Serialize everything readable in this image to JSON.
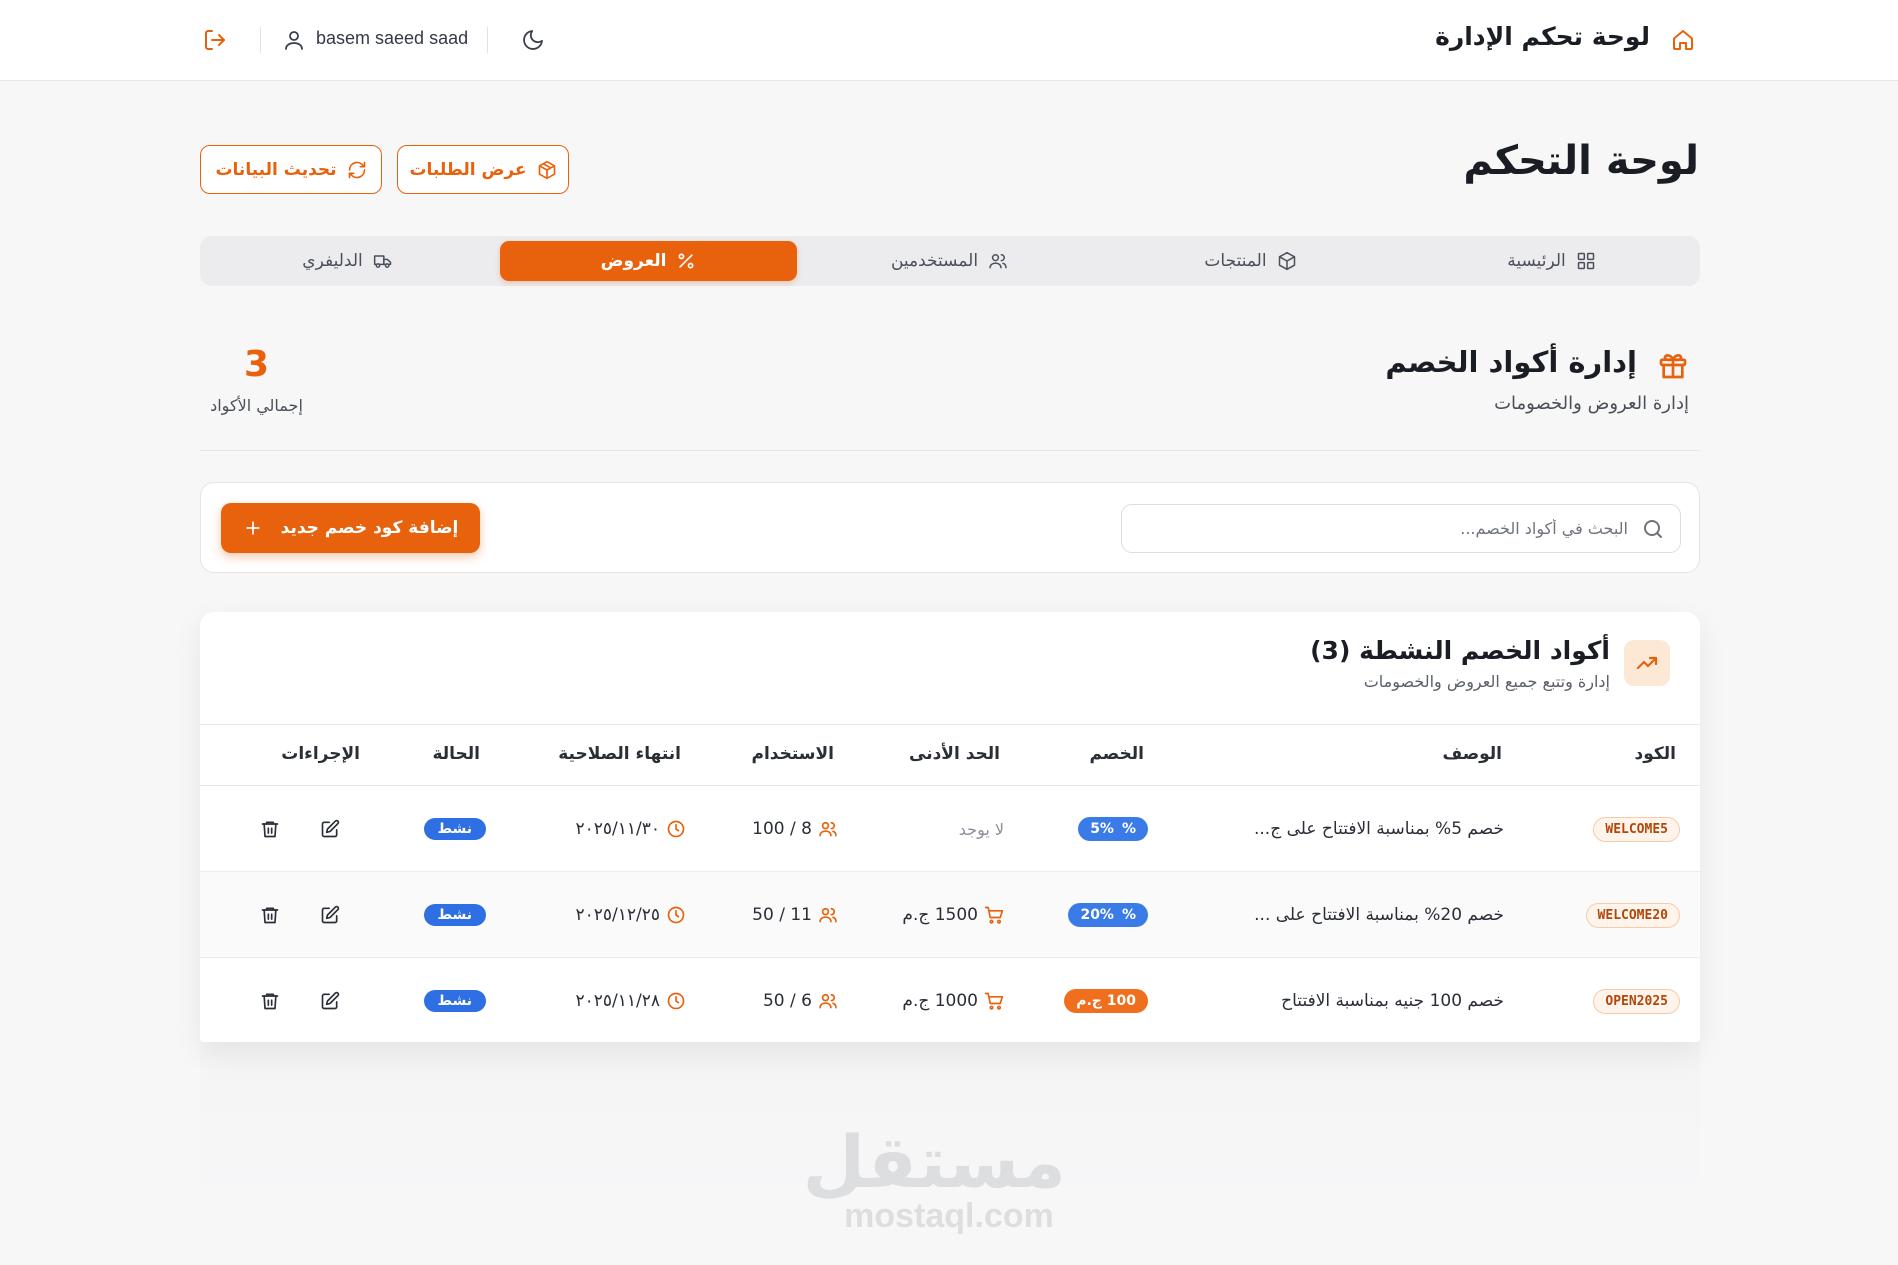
{
  "header": {
    "app_title": "لوحة تحكم الإدارة",
    "user_name": "basem saeed saad"
  },
  "page": {
    "title": "لوحة التحكم",
    "refresh_label": "تحديث البيانات",
    "orders_label": "عرض الطلبات"
  },
  "tabs": [
    {
      "label": "الرئيسية",
      "icon": "grid-icon"
    },
    {
      "label": "المنتجات",
      "icon": "box-icon"
    },
    {
      "label": "المستخدمين",
      "icon": "users-icon"
    },
    {
      "label": "العروض",
      "icon": "percent-icon",
      "active": true
    },
    {
      "label": "الدليفري",
      "icon": "truck-icon"
    }
  ],
  "section": {
    "title": "إدارة أكواد الخصم",
    "subtitle": "إدارة العروض والخصومات",
    "total_count": "3",
    "total_label": "إجمالي الأكواد"
  },
  "search": {
    "placeholder": "البحث في أكواد الخصم...",
    "add_label": "إضافة كود خصم جديد"
  },
  "card": {
    "title": "أكواد الخصم النشطة (3)",
    "subtitle": "إدارة وتتبع جميع العروض والخصومات"
  },
  "table": {
    "headers": {
      "code": "الكود",
      "description": "الوصف",
      "discount": "الخصم",
      "min": "الحد الأدنى",
      "usage": "الاستخدام",
      "expiry": "انتهاء الصلاحية",
      "status": "الحالة",
      "actions": "الإجراءات"
    },
    "rows": [
      {
        "code": "WELCOME5",
        "description": "خصم 5% بمناسبة الافتتاح على ج...",
        "discount": "5%",
        "discount_symbol": "%",
        "min": "لا يوجد",
        "usage": "8 / 100",
        "expiry": "٢٠٢٥/١١/٣٠",
        "status": "نشط"
      },
      {
        "code": "WELCOME20",
        "description": "خصم 20% بمناسبة الافتتاح على ...",
        "discount": "20%",
        "discount_symbol": "%",
        "min": "1500 ج.م",
        "usage": "11 / 50",
        "expiry": "٢٠٢٥/١٢/٢٥",
        "status": "نشط"
      },
      {
        "code": "OPEN2025",
        "description": "خصم 100 جنيه بمناسبة الافتتاح",
        "discount": "100 ج.م",
        "discount_symbol": "",
        "min": "1000 ج.م",
        "usage": "6 / 50",
        "expiry": "٢٠٢٥/١١/٢٨",
        "status": "نشط"
      }
    ]
  },
  "watermark": {
    "arabic": "مستقل",
    "latin": "mostaql.com"
  },
  "colors": {
    "accent": "#e8620d",
    "status_blue": "#2f6fe4",
    "discount_blue": "#3b7be8"
  }
}
